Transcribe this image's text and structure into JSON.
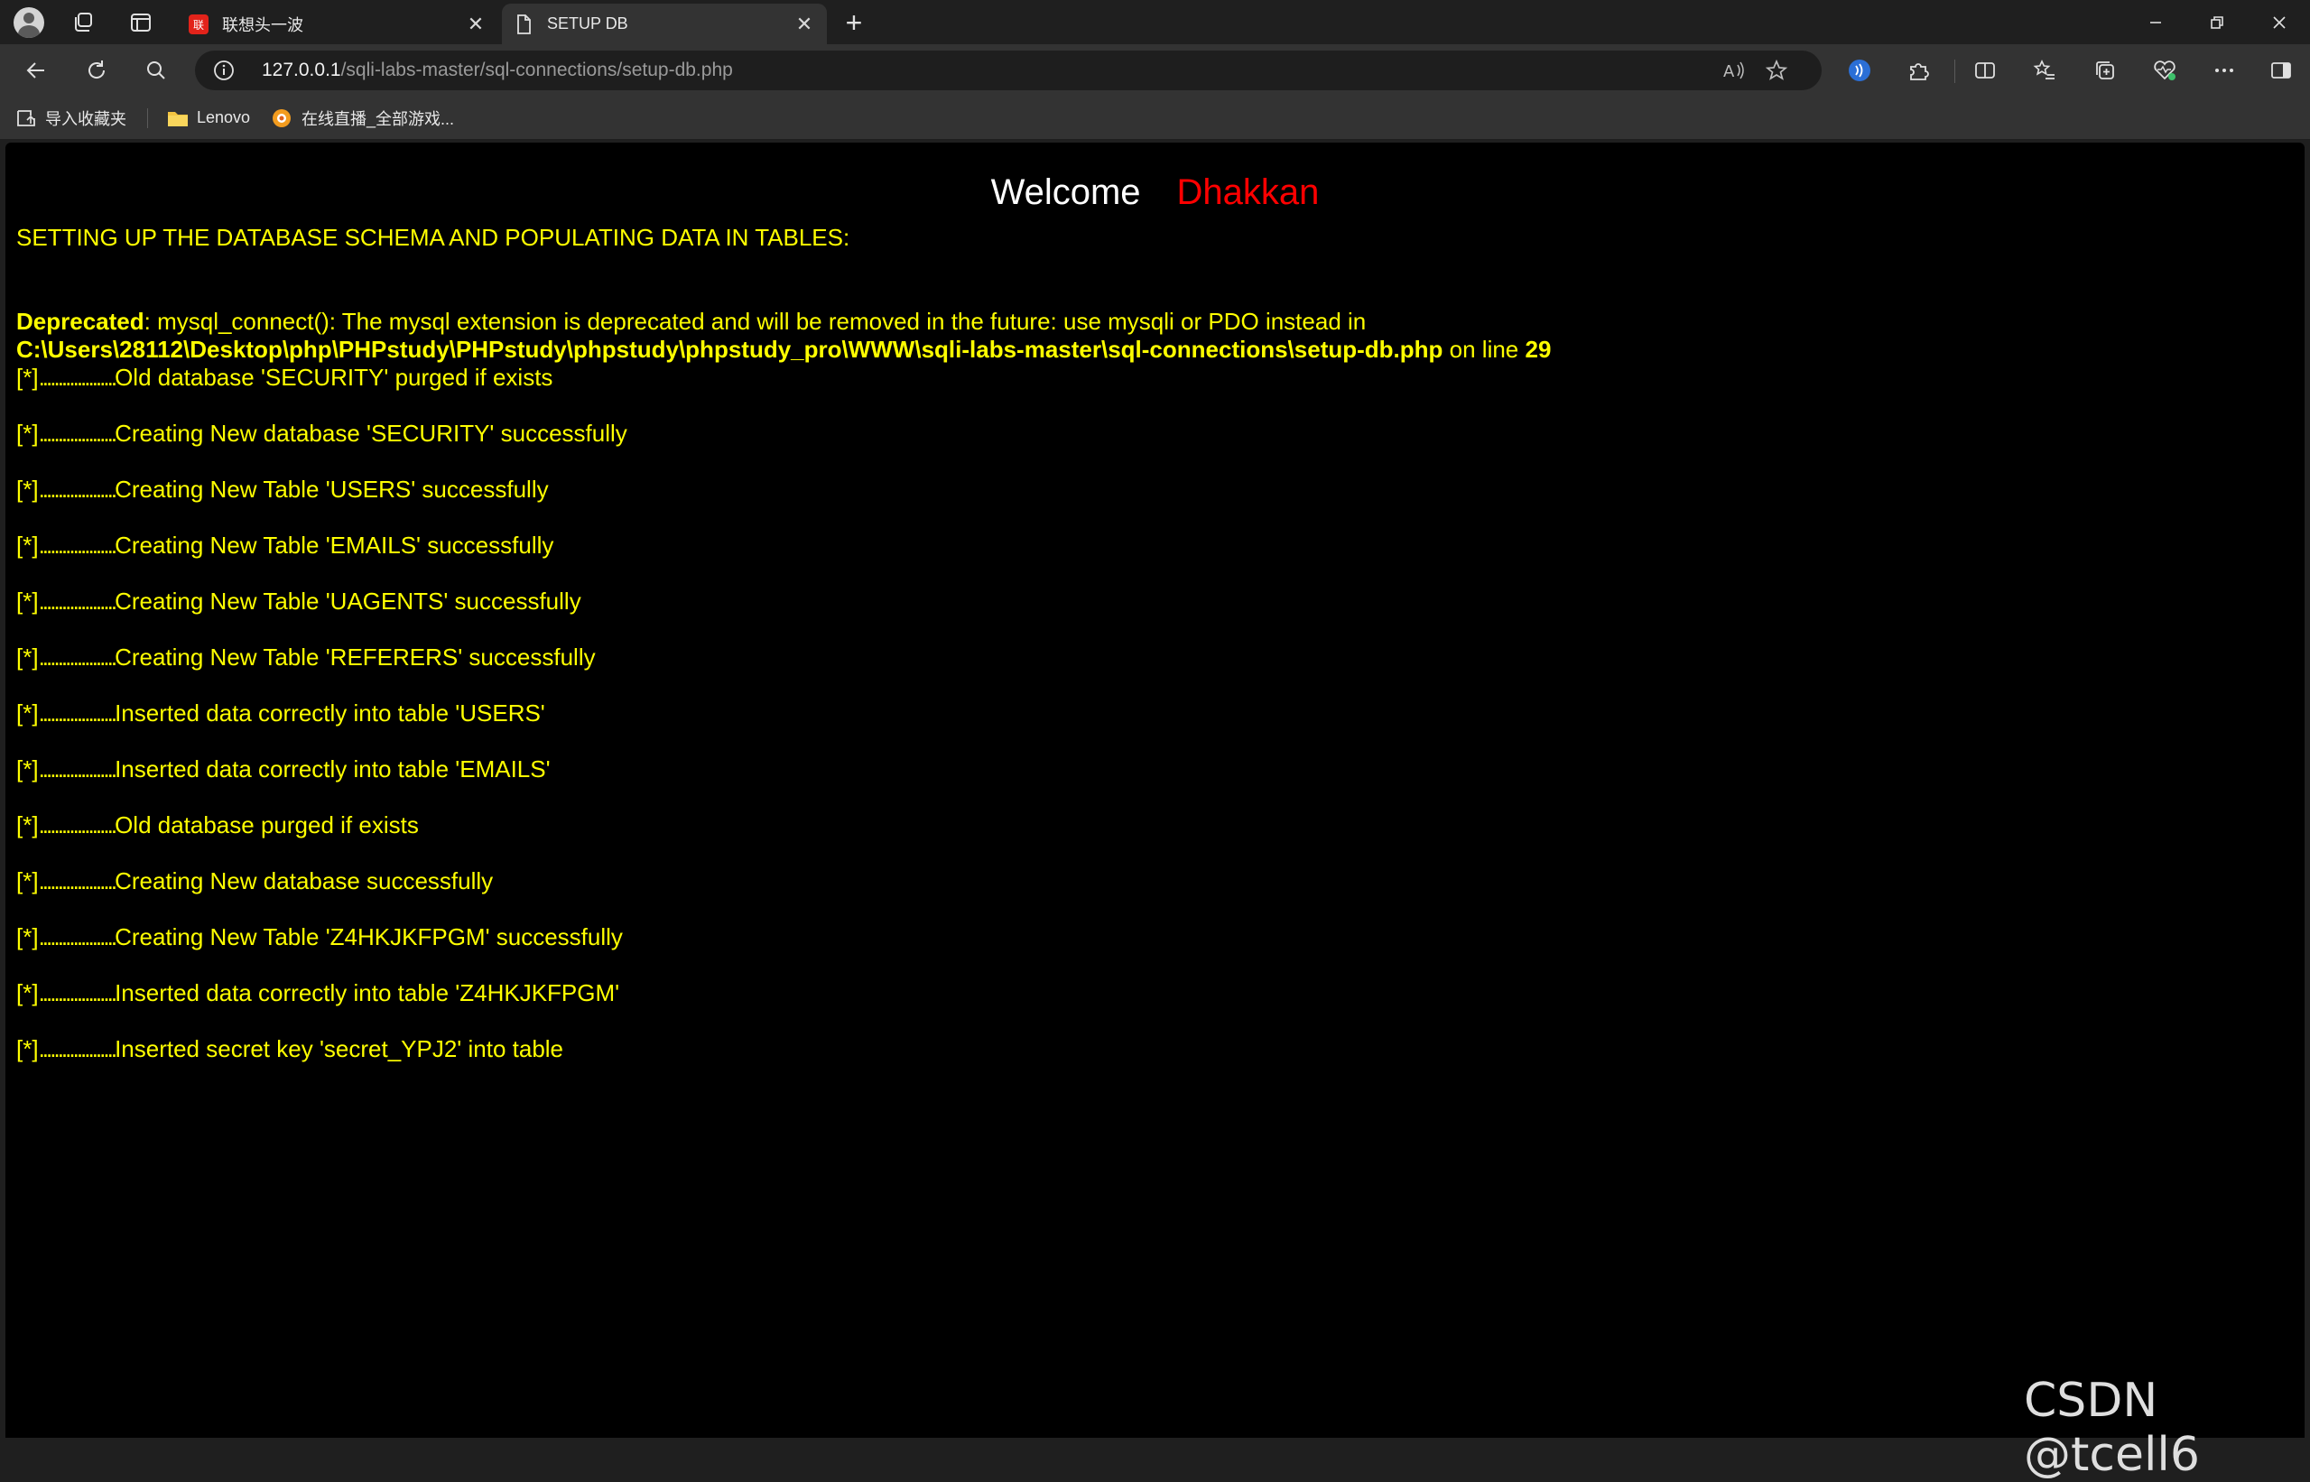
{
  "browser": {
    "tabs": [
      {
        "title": "联想头一波",
        "active": false
      },
      {
        "title": "SETUP DB",
        "active": true
      }
    ],
    "url_host": "127.0.0.1",
    "url_path": "/sqli-labs-master/sql-connections/setup-db.php",
    "bookmarks": [
      {
        "label": "导入收藏夹",
        "icon": "import-icon"
      },
      {
        "label": "Lenovo",
        "icon": "folder-icon"
      },
      {
        "label": "在线直播_全部游戏...",
        "icon": "site-icon"
      }
    ]
  },
  "page": {
    "welcome_word": "Welcome",
    "welcome_name": "Dhakkan",
    "heading": "SETTING UP THE DATABASE SCHEMA AND POPULATING DATA IN TABLES:",
    "deprecated": {
      "label": "Deprecated",
      "message": ": mysql_connect(): The mysql extension is deprecated and will be removed in the future: use mysqli or PDO instead in",
      "path": "C:\\Users\\28112\\Desktop\\php\\PHPstudy\\PHPstudy\\phpstudy\\phpstudy_pro\\WWW\\sqli-labs-master\\sql-connections\\setup-db.php",
      "online": " on line ",
      "line": "29"
    },
    "log_prefix": "[*]",
    "log_dots": "....................",
    "log": [
      "Old database 'SECURITY' purged if exists",
      "Creating New database 'SECURITY' successfully",
      "Creating New Table 'USERS' successfully",
      "Creating New Table 'EMAILS' successfully",
      "Creating New Table 'UAGENTS' successfully",
      "Creating New Table 'REFERERS' successfully",
      "Inserted data correctly into table 'USERS'",
      "Inserted data correctly into table 'EMAILS'",
      "Old database purged if exists",
      "Creating New database successfully",
      "Creating New Table 'Z4HKJKFPGM' successfully",
      "Inserted data correctly into table 'Z4HKJKFPGM'",
      "Inserted secret key 'secret_YPJ2' into table"
    ]
  },
  "watermark": "CSDN @tcell6",
  "colors": {
    "page_bg": "#000000",
    "text_yellow": "#ffff00",
    "name_red": "#ff0000",
    "chrome_dark": "#1f1f1f",
    "chrome_mid": "#333333"
  }
}
